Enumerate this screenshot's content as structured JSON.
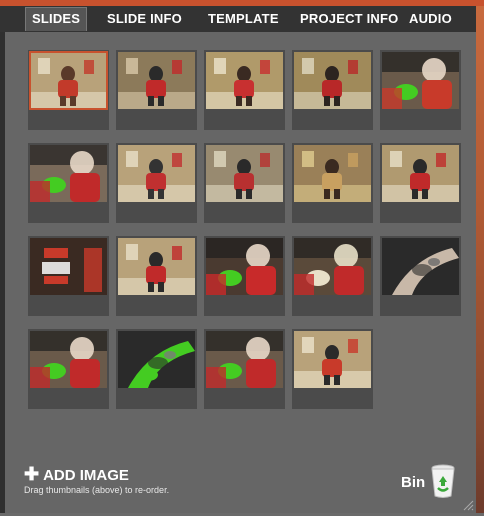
{
  "tabs": [
    {
      "label": "SLIDES",
      "active": true
    },
    {
      "label": "SLIDE INFO",
      "active": false
    },
    {
      "label": "TEMPLATE",
      "active": false
    },
    {
      "label": "PROJECT INFO",
      "active": false
    },
    {
      "label": "AUDIO",
      "active": false
    }
  ],
  "thumbnails": [
    {
      "index": 1,
      "selected": true,
      "palette": [
        "#b8a27a",
        "#5a3a2a",
        "#c23a2a",
        "#e8e0c8"
      ],
      "icon": "photo-tattoo-studio"
    },
    {
      "index": 2,
      "selected": false,
      "palette": [
        "#8c7a5a",
        "#2a2a2a",
        "#c02a2a",
        "#d8c8a8"
      ],
      "icon": "photo-tattoo-studio"
    },
    {
      "index": 3,
      "selected": false,
      "palette": [
        "#b09a6a",
        "#3a2a22",
        "#c83030",
        "#ece4cc"
      ],
      "icon": "photo-tattoo-studio"
    },
    {
      "index": 4,
      "selected": false,
      "palette": [
        "#a08a5a",
        "#2c2420",
        "#b82828",
        "#e0d8c0"
      ],
      "icon": "photo-tattoo-studio"
    },
    {
      "index": 5,
      "selected": false,
      "palette": [
        "#6a5a4a",
        "#1e1e1e",
        "#c83a2a",
        "#44cc22"
      ],
      "icon": "photo-tattoo-closeup"
    },
    {
      "index": 6,
      "selected": false,
      "palette": [
        "#7a6a5a",
        "#202020",
        "#c02a2a",
        "#44cc22"
      ],
      "icon": "photo-tattoo-closeup"
    },
    {
      "index": 7,
      "selected": false,
      "palette": [
        "#b8a27a",
        "#333333",
        "#c03030",
        "#e8e0c8"
      ],
      "icon": "photo-tattoo-studio"
    },
    {
      "index": 8,
      "selected": false,
      "palette": [
        "#988a70",
        "#2a2a2a",
        "#b83030",
        "#e0d8c0"
      ],
      "icon": "photo-tattoo-studio"
    },
    {
      "index": 9,
      "selected": false,
      "palette": [
        "#9a8058",
        "#3a2a20",
        "#c8a060",
        "#e0cc90"
      ],
      "icon": "photo-tattoo-studio"
    },
    {
      "index": 10,
      "selected": false,
      "palette": [
        "#b09a70",
        "#2a2a2a",
        "#c02a2a",
        "#e8e0c8"
      ],
      "icon": "photo-tattoo-studio"
    },
    {
      "index": 11,
      "selected": false,
      "palette": [
        "#3a2a22",
        "#c83a2a",
        "#f0f0f0",
        "#5a8a3a"
      ],
      "icon": "photo-neon-sign"
    },
    {
      "index": 12,
      "selected": false,
      "palette": [
        "#b8a27a",
        "#2a2a2a",
        "#c02a2a",
        "#e8e0c8"
      ],
      "icon": "photo-tattoo-studio"
    },
    {
      "index": 13,
      "selected": false,
      "palette": [
        "#4a3a30",
        "#1e1e1e",
        "#c82a2a",
        "#44cc22"
      ],
      "icon": "photo-tattoo-closeup"
    },
    {
      "index": 14,
      "selected": false,
      "palette": [
        "#5a4a3a",
        "#1e1e1e",
        "#c02a2a",
        "#e8e0c8"
      ],
      "icon": "photo-tattoo-closeup"
    },
    {
      "index": 15,
      "selected": false,
      "palette": [
        "#8a7a6a",
        "#2a2a2a",
        "#6a6a6a",
        "#c8b8a8"
      ],
      "icon": "photo-tattoo-arm"
    },
    {
      "index": 16,
      "selected": false,
      "palette": [
        "#6a5a4a",
        "#1e1e1e",
        "#c02a2a",
        "#44cc22"
      ],
      "icon": "photo-tattoo-closeup"
    },
    {
      "index": 17,
      "selected": false,
      "palette": [
        "#8a7a6a",
        "#2a2a2a",
        "#7a7a7a",
        "#44cc22"
      ],
      "icon": "photo-tattoo-arm"
    },
    {
      "index": 18,
      "selected": false,
      "palette": [
        "#6a5a4a",
        "#1e1e1e",
        "#c02a2a",
        "#44cc22"
      ],
      "icon": "photo-tattoo-closeup"
    },
    {
      "index": 19,
      "selected": false,
      "palette": [
        "#b8a27a",
        "#2a2a2a",
        "#c83a2a",
        "#ece4cc"
      ],
      "icon": "photo-tattoo-studio"
    }
  ],
  "add_image": {
    "label": "ADD IMAGE",
    "icon": "plus-icon"
  },
  "hint": "Drag thumbnails (above) to re-order.",
  "bin": {
    "label": "Bin",
    "icon": "recycle-bin-icon"
  },
  "colors": {
    "accent": "#c8522e",
    "panel": "#666666",
    "tabbar": "#333333",
    "recycle_green": "#3aa83a"
  }
}
